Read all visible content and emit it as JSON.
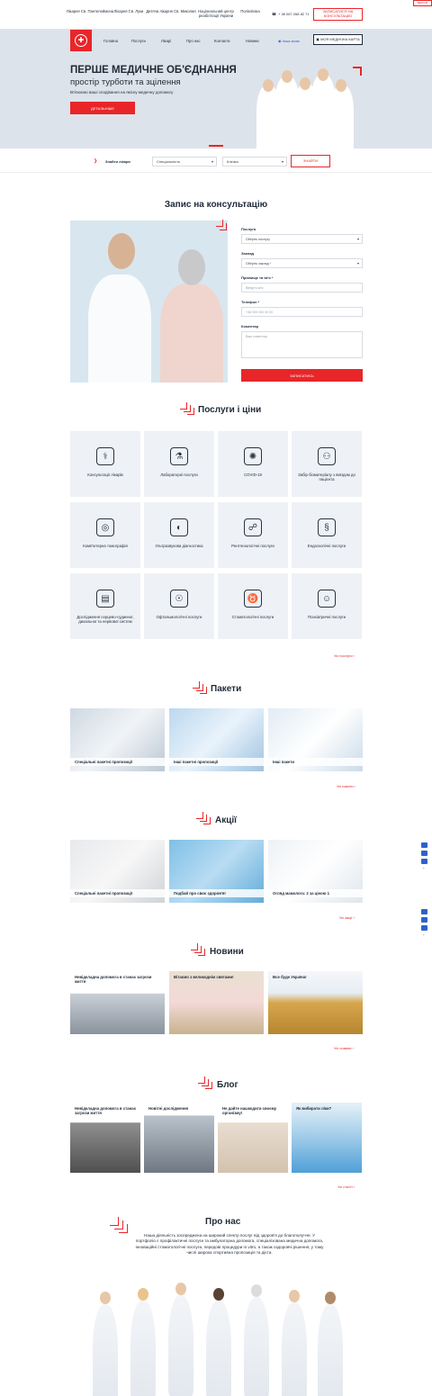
{
  "top_links": [
    "Лікарня Св. Пантелеймона",
    "Лікарня Св. Луки",
    "Дитяча лікарня Св. Миколая",
    "Національний центр реабілітації України",
    "Поліклініка"
  ],
  "phone": "+ 38 067 268 82 71",
  "consult_btn": "ЗАПИСАТИСЯ НА КОНСУЛЬТАЦІЮ",
  "corner_badge": "ВЕРСІЯ",
  "nav": [
    "Головна",
    "Послуги",
    "Лікарі",
    "Про нас",
    "Контакти",
    "Новини"
  ],
  "lang": "Інша мова",
  "medcard_btn": "МОЯ МЕДИЧНА КАРТА",
  "hero": {
    "title": "ПЕРШЕ МЕДИЧНЕ ОБ'ЄДНАННЯ",
    "subtitle": "простір турботи та зцілення",
    "text": "Втілюємо ваші сподівання на якісну медичну допомогу",
    "button": "ДЕТАЛЬНІШЕ"
  },
  "search": {
    "label": "Знайти лікаря",
    "specialty": "Спеціальність",
    "clinic": "Клініка",
    "button": "ЗНАЙТИ"
  },
  "consult": {
    "title": "Запис на консультацію",
    "service_label": "Послуга",
    "service_ph": "Оберіть послугу",
    "place_label": "Заклад",
    "place_ph": "Оберіть заклад *",
    "name_label": "Прізвище та ім'я *",
    "name_ph": "Введіть ім'я",
    "phone_label": "Телефон *",
    "phone_ph": "+38 000 000 00 00",
    "comment_label": "Коментар",
    "comment_ph": "Ваш коментар",
    "submit": "ЗАПИСАТИСЬ"
  },
  "services": {
    "title": "Послуги і ціни",
    "more": "Усі послуги",
    "items": [
      "Консультації лікарів",
      "Лабораторні послуги",
      "COVID-19",
      "Забір біоматеріалу з виїздом до пацієнта",
      "Комп'ютерна томографія",
      "Ультразвукова діагностика",
      "Рентгенологічні послуги",
      "Ендоскопічні послуги",
      "Дослідження серцево-судинної, дихальної та нервової систем",
      "Офтальмологічні послуги",
      "Стоматологічні послуги",
      "Психіатричні послуги"
    ]
  },
  "packages": {
    "title": "Пакети",
    "more": "Усі пакети",
    "items": [
      "Спеціальні пакетні пропозиції",
      "Інші пакетні пропозиції",
      "Інші пакети"
    ]
  },
  "promos": {
    "title": "Акції",
    "more": "Усі акції",
    "items": [
      "Спеціальні пакетні пропозиції",
      "Подбай про своє здоров'я!",
      "Огляд мамолога: 2 за ціною 1"
    ]
  },
  "news": {
    "title": "Новини",
    "more": "Усі новини",
    "items": [
      "Невідкладна допомога в станах загрози життя",
      "Вітаємо з великоднім святами!",
      "Все буде Україна!"
    ]
  },
  "blog": {
    "title": "Блог",
    "more": "Усі статті",
    "items": [
      "Невідкладна допомога в станах загрози життя",
      "Новітні дослідження",
      "Не дайте нашкодити своєму організму!",
      "Як вибирати ліки?"
    ]
  },
  "about": {
    "title": "Про нас",
    "text": "Наша діяльність зосереджена на широкий спектр послуг від здоров'я до благополуччя. У портфоліо є профілактичні послуги та амбулаторна допомога, спеціалізована медична допомога, інноваційні стоматологічні послуги, передові процедури in vitro, а також оздоровчі рішення, у тому числі широка спортивна пропозиція та дієта."
  }
}
